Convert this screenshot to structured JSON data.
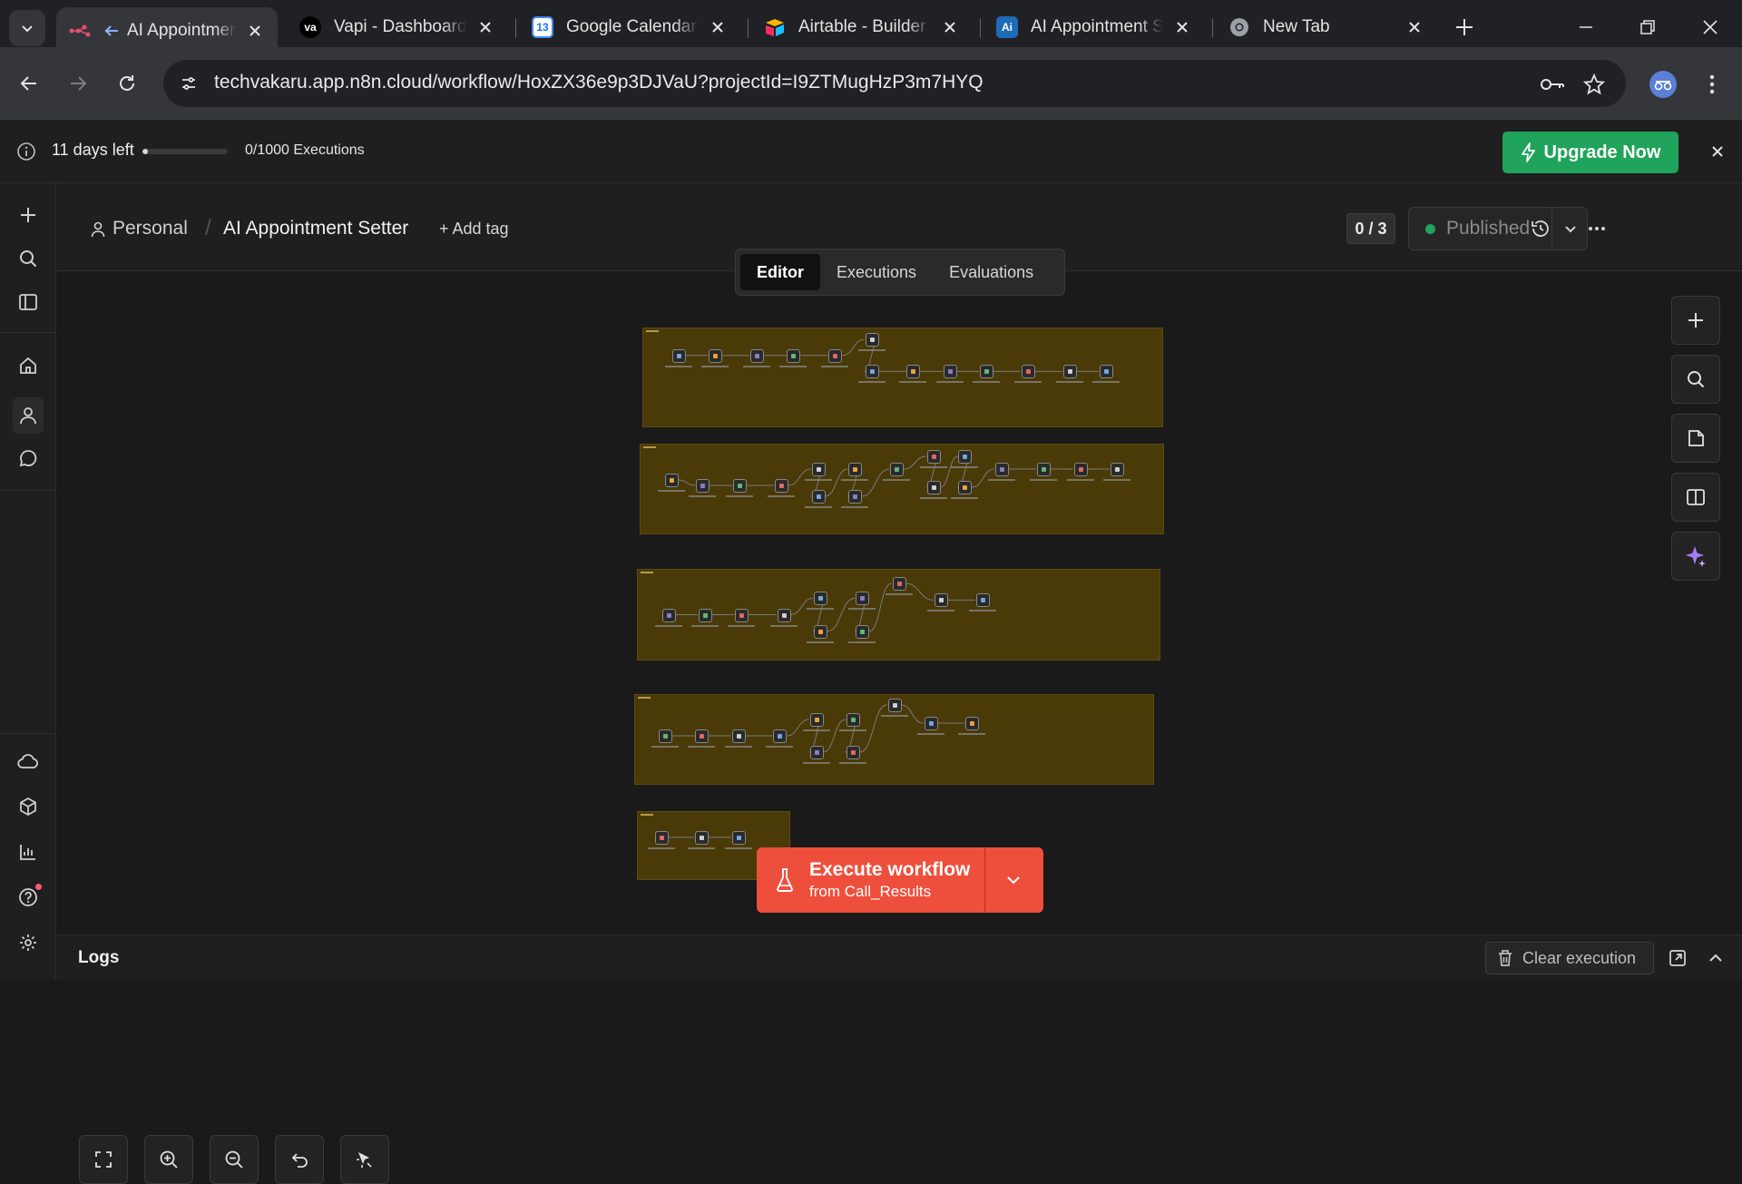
{
  "browser": {
    "tabs": [
      {
        "label": "AI Appointmen",
        "active": true,
        "favicon": "n8n-icon"
      },
      {
        "label": "Vapi - Dashboard",
        "active": false,
        "favicon": "vapi-icon"
      },
      {
        "label": "Google Calendar -",
        "active": false,
        "favicon": "google-calendar-icon"
      },
      {
        "label": "Airtable - Builder H",
        "active": false,
        "favicon": "airtable-icon"
      },
      {
        "label": "AI Appointment Se",
        "active": false,
        "favicon": "ai-icon"
      },
      {
        "label": "New Tab",
        "active": false,
        "favicon": "chrome-icon"
      }
    ],
    "url": "techvakaru.app.n8n.cloud/workflow/HoxZX36e9p3DJVaU?projectId=I9ZTMugHzP3m7HYQ"
  },
  "banner": {
    "days_left": "11 days left",
    "executions": "0/1000 Executions",
    "progress": 0.06,
    "upgrade_label": "Upgrade Now",
    "accent": "#20a35a"
  },
  "header": {
    "project": "Personal",
    "workflow_title": "AI Appointment Setter",
    "add_tag": "+ Add tag",
    "counter": "0 / 3",
    "status": "Published"
  },
  "mode_tabs": [
    "Editor",
    "Executions",
    "Evaluations"
  ],
  "execute": {
    "label": "Execute workflow",
    "sublabel": "from Call_Results",
    "color": "#ee4f3c"
  },
  "logs": {
    "title": "Logs",
    "clear_label": "Clear execution"
  },
  "icons": {
    "sidebar_top": [
      "plus-icon",
      "search-icon",
      "panel-icon",
      "home-icon",
      "user-icon",
      "chat-icon"
    ],
    "sidebar_bottom": [
      "cloud-icon",
      "cube-icon",
      "chart-icon",
      "help-icon",
      "settings-icon"
    ],
    "right_tools": [
      "plus-icon",
      "search-icon",
      "sticky-note-icon",
      "panel-icon",
      "sparkle-icon"
    ],
    "canvas_controls": [
      "fit-view-icon",
      "zoom-in-icon",
      "zoom-out-icon",
      "undo-icon",
      "pointer-icon"
    ]
  }
}
